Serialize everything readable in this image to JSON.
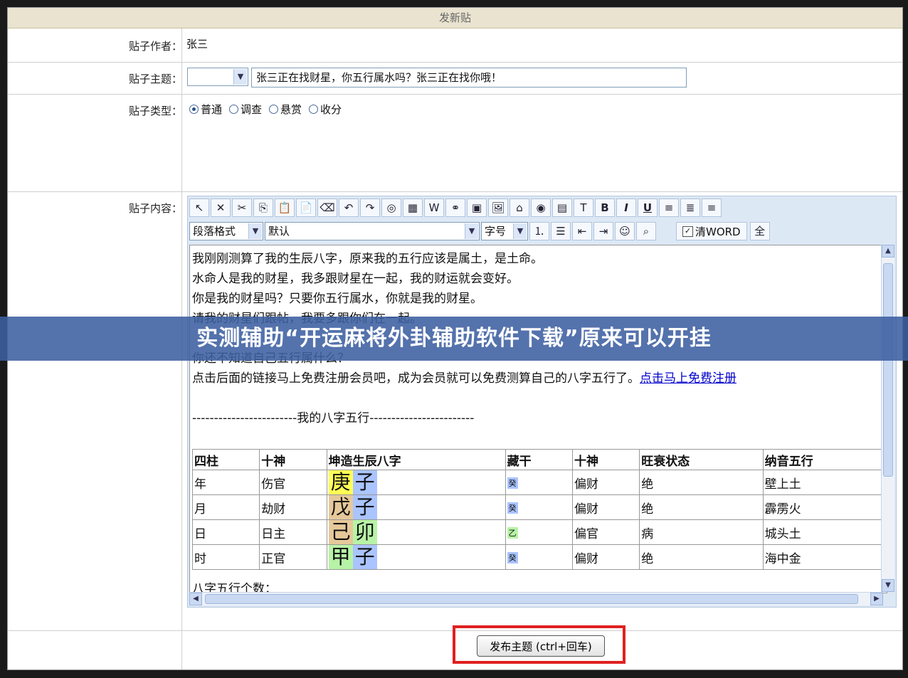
{
  "form": {
    "title": "发新贴",
    "author_label": "贴子作者：",
    "author_value": "张三",
    "subject_label": "贴子主题：",
    "subject_select_value": "",
    "subject_value": "张三正在找财星，你五行属水吗？张三正在找你哦！",
    "type_label": "贴子类型：",
    "types": [
      {
        "label": "普通",
        "checked": true
      },
      {
        "label": "调查",
        "checked": false
      },
      {
        "label": "悬赏",
        "checked": false
      },
      {
        "label": "收分",
        "checked": false
      }
    ],
    "content_label": "贴子内容："
  },
  "toolbar": {
    "row1_icons": [
      "cursor-icon",
      "cut-x-icon",
      "scissors-icon",
      "copy-icon",
      "paste-icon",
      "paste-text-icon",
      "eraser-icon",
      "undo-icon",
      "redo-icon",
      "stamp-icon",
      "table-icon",
      "web-icon",
      "link-icon",
      "image-icon",
      "insert-image-icon",
      "home-icon",
      "media-icon",
      "form-icon",
      "font-color-icon",
      "bold-icon",
      "italic-icon",
      "underline-icon",
      "align-left-icon",
      "align-center-icon",
      "align-right-icon"
    ],
    "row1_glyphs": [
      "↖",
      "✕",
      "✂",
      "⎘",
      "📋",
      "📄",
      "⌫",
      "↶",
      "↷",
      "◎",
      "▦",
      "W",
      "⚭",
      "▣",
      "🖼",
      "⌂",
      "◉",
      "▤",
      "T",
      "B",
      "I",
      "U",
      "≡",
      "≣",
      "≡"
    ],
    "paragraph_format": "段落格式",
    "font_name": "默认",
    "font_size": "字号",
    "row2_icons": [
      "ordered-list-icon",
      "unordered-list-icon",
      "outdent-icon",
      "indent-icon",
      "emoticon-icon",
      "find-icon"
    ],
    "row2_glyphs": [
      "⒈",
      "☰",
      "⇤",
      "⇥",
      "☺",
      "⌕"
    ],
    "clean_word": "清WORD",
    "clean_word_checked": true,
    "fullscreen": "全"
  },
  "content": {
    "lines": [
      "我刚刚测算了我的生辰八字，原来我的五行应该是属土，是土命。",
      "水命人是我的财星，我多跟财星在一起，我的财运就会变好。",
      "你是我的财星吗？只要你五行属水，你就是我的财星。",
      "请我的财星们跟帖，我要多跟你们在一起。",
      "你还不知道自己五行属什么？",
      "点击后面的链接马上免费注册会员吧，成为会员就可以免费测算自己的八字五行了。"
    ],
    "link_text": "点击马上免费注册",
    "divider": "------------------------我的八字五行------------------------",
    "table_headers": [
      "四柱",
      "十神",
      "坤造生辰八字",
      "藏干",
      "十神",
      "旺衰状态",
      "纳音五行"
    ],
    "table_rows": [
      {
        "pillar": "年",
        "god": "伤官",
        "stem": "庚",
        "branch": "子",
        "stem_color": "#ffff55",
        "branch_color": "#aac4ff",
        "hidden": "癸",
        "hidden_color": "#aac4ff",
        "god2": "偏财",
        "state": "绝",
        "nayin": "壁上土"
      },
      {
        "pillar": "月",
        "god": "劫财",
        "stem": "戊",
        "branch": "子",
        "stem_color": "#e6c89a",
        "branch_color": "#aac4ff",
        "hidden": "癸",
        "hidden_color": "#aac4ff",
        "god2": "偏财",
        "state": "绝",
        "nayin": "霹雳火"
      },
      {
        "pillar": "日",
        "god": "日主",
        "stem": "己",
        "branch": "卯",
        "stem_color": "#e6c89a",
        "branch_color": "#b7f3a6",
        "hidden": "乙",
        "hidden_color": "#b7f3a6",
        "god2": "偏官",
        "state": "病",
        "nayin": "城头土"
      },
      {
        "pillar": "时",
        "god": "正官",
        "stem": "甲",
        "branch": "子",
        "stem_color": "#b7f3a6",
        "branch_color": "#aac4ff",
        "hidden": "癸",
        "hidden_color": "#aac4ff",
        "god2": "偏财",
        "state": "绝",
        "nayin": "海中金"
      }
    ],
    "tail": "八字五行个数："
  },
  "submit_label": "发布主题 (ctrl+回车)",
  "banner": "实测辅助“开运麻将外卦辅助软件下载”原来可以开挂"
}
